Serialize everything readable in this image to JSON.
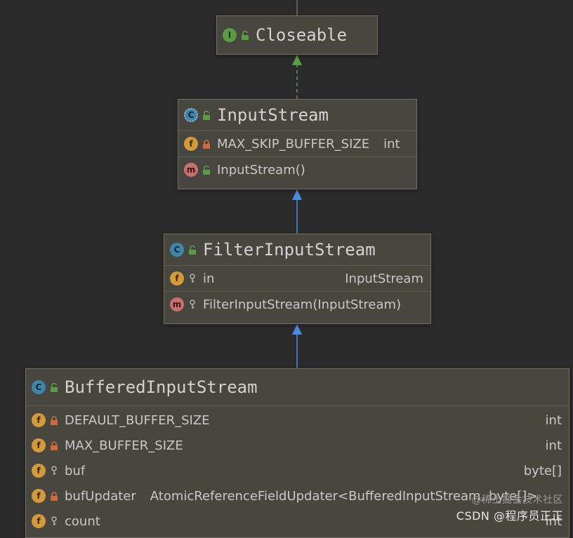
{
  "diagram": {
    "nodes": [
      {
        "id": "closeable",
        "kind": "I",
        "visibility": "public",
        "name": "Closeable",
        "groups": []
      },
      {
        "id": "inputstream",
        "kind": "C",
        "abstract": true,
        "visibility": "public",
        "name": "InputStream",
        "groups": [
          [
            {
              "kind": "f",
              "visibility": "private",
              "static": true,
              "name": "MAX_SKIP_BUFFER_SIZE",
              "type": "int",
              "type_inline": true
            }
          ],
          [
            {
              "kind": "m",
              "visibility": "public",
              "name": "InputStream()",
              "type": ""
            }
          ]
        ]
      },
      {
        "id": "filterinputstream",
        "kind": "C",
        "visibility": "public",
        "name": "FilterInputStream",
        "groups": [
          [
            {
              "kind": "f",
              "visibility": "protected",
              "name": "in",
              "type": "InputStream"
            }
          ],
          [
            {
              "kind": "m",
              "visibility": "protected",
              "name": "FilterInputStream(InputStream)",
              "type": ""
            }
          ]
        ]
      },
      {
        "id": "bufferedinputstream",
        "kind": "C",
        "visibility": "public",
        "name": "BufferedInputStream",
        "groups": [
          [
            {
              "kind": "f",
              "visibility": "private",
              "static": true,
              "name": "DEFAULT_BUFFER_SIZE",
              "type": "int"
            },
            {
              "kind": "f",
              "visibility": "private",
              "static": true,
              "name": "MAX_BUFFER_SIZE",
              "type": "int"
            },
            {
              "kind": "f",
              "visibility": "protected",
              "name": "buf",
              "type": "byte[]"
            },
            {
              "kind": "f",
              "visibility": "private",
              "static": true,
              "name": "bufUpdater",
              "type": "AtomicReferenceFieldUpdater<BufferedInputStream, byte[]>",
              "type_inline": true
            },
            {
              "kind": "f",
              "visibility": "protected",
              "name": "count",
              "type": "int"
            }
          ]
        ]
      }
    ],
    "edges": [
      {
        "from": "inputstream",
        "to": "closeable",
        "type": "implements",
        "color": "#5c9b46"
      },
      {
        "from": "filterinputstream",
        "to": "inputstream",
        "type": "extends",
        "color": "#4a8be0"
      },
      {
        "from": "bufferedinputstream",
        "to": "filterinputstream",
        "type": "extends",
        "color": "#4a8be0"
      }
    ]
  },
  "watermark": {
    "line1": "@稀土掘金技术社区",
    "line2": "CSDN @程序员正正"
  }
}
